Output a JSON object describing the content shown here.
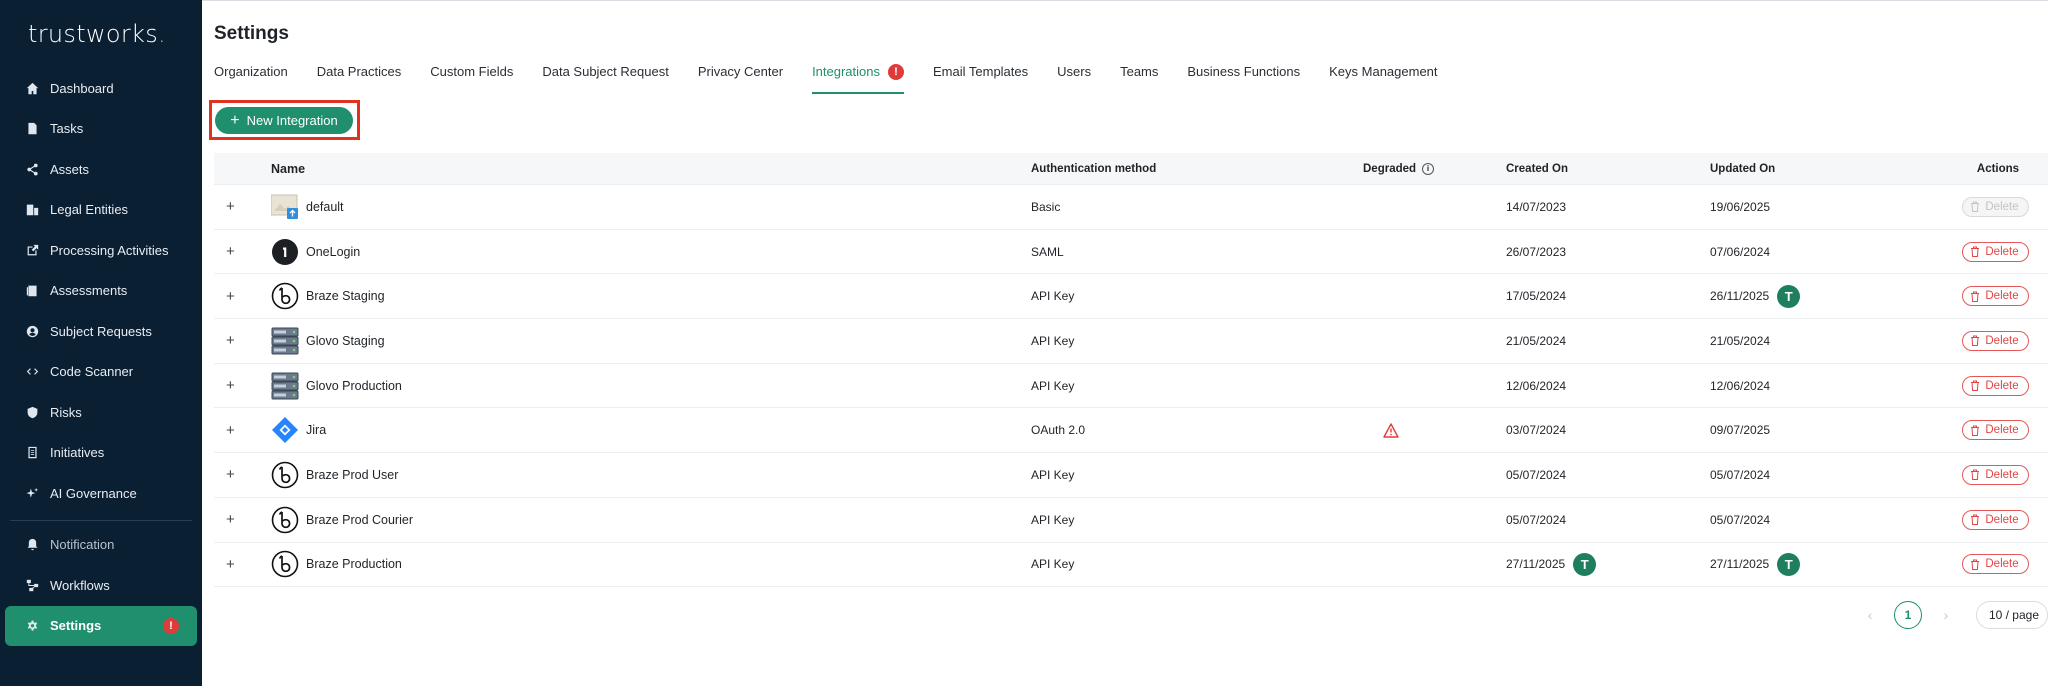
{
  "brand": {
    "name": "trustworks",
    "dot": "."
  },
  "sidebar": {
    "items": [
      {
        "label": "Dashboard",
        "icon": "home-icon"
      },
      {
        "label": "Tasks",
        "icon": "document-icon"
      },
      {
        "label": "Assets",
        "icon": "share-nodes-icon"
      },
      {
        "label": "Legal Entities",
        "icon": "building-icon"
      },
      {
        "label": "Processing Activities",
        "icon": "external-link-icon"
      },
      {
        "label": "Assessments",
        "icon": "clipboard-icon"
      },
      {
        "label": "Subject Requests",
        "icon": "user-circle-icon"
      },
      {
        "label": "Code Scanner",
        "icon": "code-icon"
      },
      {
        "label": "Risks",
        "icon": "shield-icon"
      },
      {
        "label": "Initiatives",
        "icon": "list-icon"
      },
      {
        "label": "AI Governance",
        "icon": "sparkle-icon"
      }
    ],
    "bottom_items": [
      {
        "label": "Notification",
        "icon": "bell-icon"
      },
      {
        "label": "Workflows",
        "icon": "workflow-icon"
      },
      {
        "label": "Settings",
        "icon": "gear-icon",
        "badge": "!"
      }
    ]
  },
  "page": {
    "title": "Settings"
  },
  "tabs": [
    {
      "label": "Organization"
    },
    {
      "label": "Data Practices"
    },
    {
      "label": "Custom Fields"
    },
    {
      "label": "Data Subject Request"
    },
    {
      "label": "Privacy Center"
    },
    {
      "label": "Integrations",
      "active": true,
      "badge": "!"
    },
    {
      "label": "Email Templates"
    },
    {
      "label": "Users"
    },
    {
      "label": "Teams"
    },
    {
      "label": "Business Functions"
    },
    {
      "label": "Keys Management"
    }
  ],
  "toolbar": {
    "new_label": "New Integration",
    "plus": "+"
  },
  "table": {
    "headers": {
      "name": "Name",
      "auth": "Authentication method",
      "degraded": "Degraded",
      "created": "Created On",
      "updated": "Updated On",
      "actions": "Actions"
    },
    "delete_label": "Delete",
    "expand_symbol": "+",
    "rows": [
      {
        "name": "default",
        "logo": "image-placeholder-icon",
        "auth": "Basic",
        "degraded": false,
        "created": "14/07/2023",
        "created_avatar": "",
        "updated": "19/06/2025",
        "updated_avatar": "",
        "delete_disabled": true
      },
      {
        "name": "OneLogin",
        "logo": "onelogin-icon",
        "auth": "SAML",
        "degraded": false,
        "created": "26/07/2023",
        "created_avatar": "",
        "updated": "07/06/2024",
        "updated_avatar": "",
        "delete_disabled": false
      },
      {
        "name": "Braze Staging",
        "logo": "braze-icon",
        "auth": "API Key",
        "degraded": false,
        "created": "17/05/2024",
        "created_avatar": "",
        "updated": "26/11/2025",
        "updated_avatar": "T",
        "delete_disabled": false
      },
      {
        "name": "Glovo Staging",
        "logo": "server-stack-icon",
        "auth": "API Key",
        "degraded": false,
        "created": "21/05/2024",
        "created_avatar": "",
        "updated": "21/05/2024",
        "updated_avatar": "",
        "delete_disabled": false
      },
      {
        "name": "Glovo Production",
        "logo": "server-stack-icon",
        "auth": "API Key",
        "degraded": false,
        "created": "12/06/2024",
        "created_avatar": "",
        "updated": "12/06/2024",
        "updated_avatar": "",
        "delete_disabled": false
      },
      {
        "name": "Jira",
        "logo": "jira-icon",
        "auth": "OAuth 2.0",
        "degraded": true,
        "created": "03/07/2024",
        "created_avatar": "",
        "updated": "09/07/2025",
        "updated_avatar": "",
        "delete_disabled": false
      },
      {
        "name": "Braze Prod User",
        "logo": "braze-icon",
        "auth": "API Key",
        "degraded": false,
        "created": "05/07/2024",
        "created_avatar": "",
        "updated": "05/07/2024",
        "updated_avatar": "",
        "delete_disabled": false
      },
      {
        "name": "Braze Prod Courier",
        "logo": "braze-icon",
        "auth": "API Key",
        "degraded": false,
        "created": "05/07/2024",
        "created_avatar": "",
        "updated": "05/07/2024",
        "updated_avatar": "",
        "delete_disabled": false
      },
      {
        "name": "Braze Production",
        "logo": "braze-icon",
        "auth": "API Key",
        "degraded": false,
        "created": "27/11/2025",
        "created_avatar": "T",
        "updated": "27/11/2025",
        "updated_avatar": "T",
        "delete_disabled": false
      }
    ]
  },
  "pagination": {
    "prev": "‹",
    "current": "1",
    "next": "›",
    "page_size": "10 / page"
  },
  "colors": {
    "accent": "#1f8f6e",
    "sidebar_bg": "#0b1f33",
    "danger": "#e04545",
    "highlight_border": "#e0321f"
  }
}
